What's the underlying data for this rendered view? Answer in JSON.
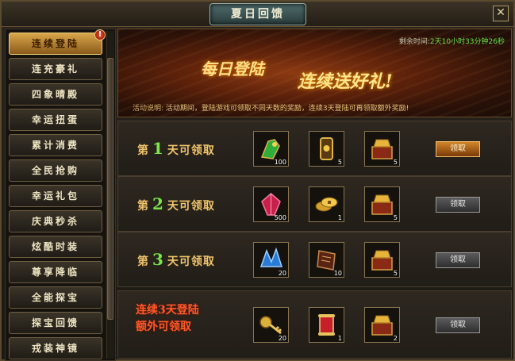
{
  "window": {
    "title": "夏日回馈",
    "close_label": "✕"
  },
  "sidebar": {
    "items": [
      {
        "label": "连续登陆",
        "active": true,
        "badge": "!"
      },
      {
        "label": "连充豪礼"
      },
      {
        "label": "四象晴殿"
      },
      {
        "label": "幸运扭蛋"
      },
      {
        "label": "累计消费"
      },
      {
        "label": "全民抢购"
      },
      {
        "label": "幸运礼包"
      },
      {
        "label": "庆典秒杀"
      },
      {
        "label": "炫酷时装"
      },
      {
        "label": "尊享降临"
      },
      {
        "label": "全能探宝"
      },
      {
        "label": "探宝回馈"
      },
      {
        "label": "戎装神镜"
      }
    ]
  },
  "banner": {
    "timer_label": "剩余时间:",
    "timer_value": "2天10小时33分钟26秒",
    "headline_1": "每日登陆",
    "headline_2": "连续送好礼!",
    "desc_label": "活动说明:",
    "desc_text": "活动期间，登陆游戏可领取不同天数的奖励，连续3天登陆可再领取额外奖励!"
  },
  "rows": [
    {
      "prefix": "第",
      "num": "1",
      "suffix": "天可领取",
      "claim_label": "领取",
      "claim_ready": true,
      "items": [
        {
          "icon": "green-jade-statue-icon",
          "count": "100"
        },
        {
          "icon": "golden-token-icon",
          "count": "5"
        },
        {
          "icon": "treasure-chest-icon",
          "count": "5"
        }
      ]
    },
    {
      "prefix": "第",
      "num": "2",
      "suffix": "天可领取",
      "claim_label": "领取",
      "claim_ready": false,
      "items": [
        {
          "icon": "red-gem-icon",
          "count": "500"
        },
        {
          "icon": "gold-coins-icon",
          "count": "1"
        },
        {
          "icon": "treasure-chest-icon",
          "count": "5"
        }
      ]
    },
    {
      "prefix": "第",
      "num": "3",
      "suffix": "天可领取",
      "claim_label": "领取",
      "claim_ready": false,
      "items": [
        {
          "icon": "blue-crystal-icon",
          "count": "20"
        },
        {
          "icon": "skill-book-icon",
          "count": "10"
        },
        {
          "icon": "treasure-chest-icon",
          "count": "5"
        }
      ]
    },
    {
      "special_line_1": "连续3天登陆",
      "special_line_2": "额外可领取",
      "claim_label": "领取",
      "claim_ready": false,
      "items": [
        {
          "icon": "golden-key-icon",
          "count": "20"
        },
        {
          "icon": "red-scroll-icon",
          "count": "1"
        },
        {
          "icon": "treasure-chest-icon",
          "count": "2"
        }
      ]
    }
  ],
  "colors": {
    "accent_gold": "#f1c56a",
    "day_number_green": "#79e64a",
    "special_red": "#ff5a2a",
    "timer_green": "#66e24a"
  }
}
